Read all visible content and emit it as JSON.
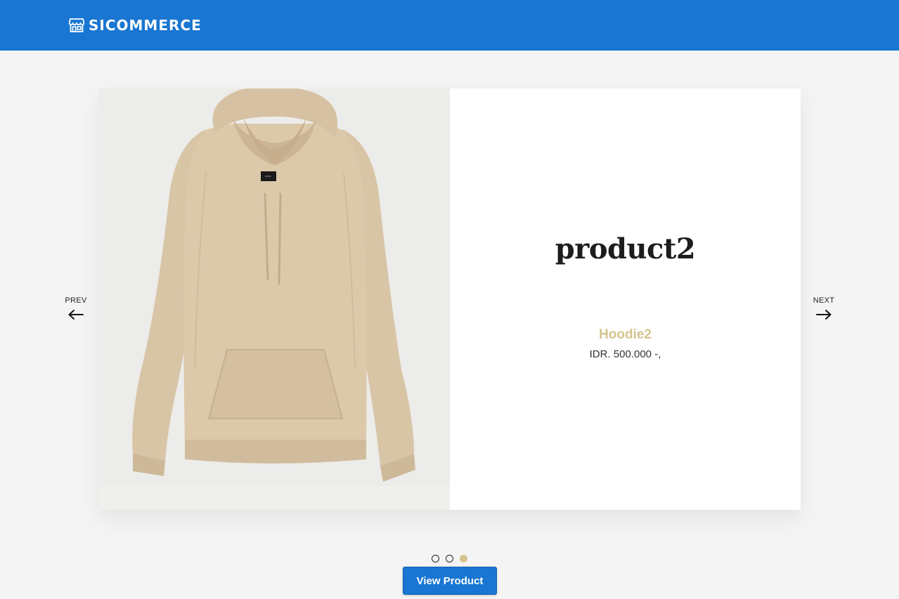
{
  "header": {
    "brand_icon": "store-icon",
    "brand_name": "SICOMMERCE",
    "background_color": "#1976d2"
  },
  "slider": {
    "prev_label": "PREV",
    "next_label": "NEXT",
    "prev_icon": "arrow-left-icon",
    "next_icon": "arrow-right-icon",
    "slide": {
      "title": "product2",
      "product_name": "Hoodie2",
      "price": "IDR. 500.000 -,",
      "image_description": "beige hoodie",
      "accent_color": "#d5c48e"
    },
    "dots": [
      {
        "active": false
      },
      {
        "active": false
      },
      {
        "active": true
      }
    ],
    "dot_count": 3,
    "active_index": 3
  },
  "cta": {
    "label": "View Product"
  }
}
